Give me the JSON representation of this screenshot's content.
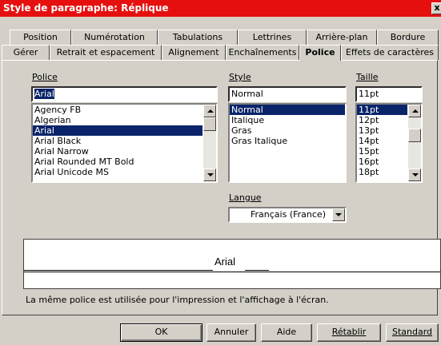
{
  "window": {
    "title": "Style de paragraphe: Réplique",
    "close_glyph": "x"
  },
  "tabs": {
    "back_row": [
      "Position",
      "Numérotation",
      "Tabulations",
      "Lettrines",
      "Arrière-plan",
      "Bordure"
    ],
    "front_row": [
      "Gérer",
      "Retrait et espacement",
      "Alignement",
      "Enchaînements",
      "Police",
      "Effets de caractères"
    ],
    "active": "Police"
  },
  "font": {
    "label": "Police",
    "value": "Arial",
    "items": [
      "Agency FB",
      "Algerian",
      "Arial",
      "Arial Black",
      "Arial Narrow",
      "Arial Rounded MT Bold",
      "Arial Unicode MS"
    ],
    "selected": "Arial"
  },
  "style": {
    "label": "Style",
    "value": "Normal",
    "items": [
      "Normal",
      "Italique",
      "Gras",
      "Gras Italique"
    ],
    "selected": "Normal"
  },
  "size": {
    "label": "Taille",
    "value": "11pt",
    "items": [
      "11pt",
      "12pt",
      "13pt",
      "14pt",
      "15pt",
      "16pt",
      "18pt"
    ],
    "selected": "11pt"
  },
  "language": {
    "label": "Langue",
    "value": "Français (France)"
  },
  "preview": {
    "sample": "Arial"
  },
  "info_text": "La même police est utilisée pour l'impression et l'affichage à l'écran.",
  "buttons": {
    "ok": "OK",
    "cancel": "Annuler",
    "help": "Aide",
    "reset": "Rétablir",
    "standard": "Standard"
  },
  "colors": {
    "titlebar": "#e60f0f",
    "selection": "#0a246a",
    "face": "#d4d0c8"
  }
}
